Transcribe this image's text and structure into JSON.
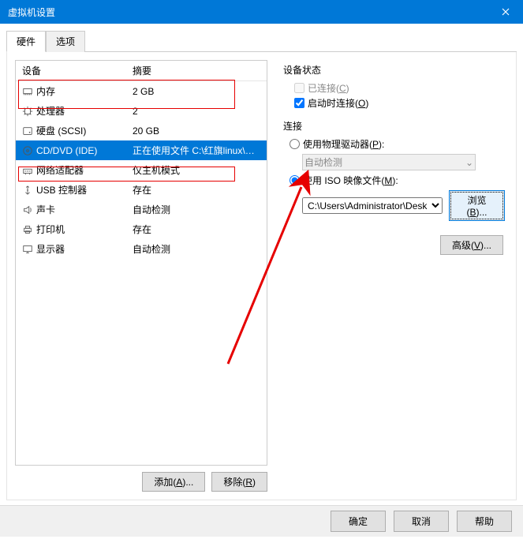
{
  "title": "虚拟机设置",
  "tabs": {
    "hardware": "硬件",
    "options": "选项"
  },
  "hw": {
    "headers": {
      "device": "设备",
      "summary": "摘要"
    },
    "items": [
      {
        "icon": "memory",
        "label": "内存",
        "summary": "2 GB"
      },
      {
        "icon": "cpu",
        "label": "处理器",
        "summary": "2"
      },
      {
        "icon": "disk",
        "label": "硬盘 (SCSI)",
        "summary": "20 GB"
      },
      {
        "icon": "cd",
        "label": "CD/DVD (IDE)",
        "summary": "正在使用文件 C:\\红旗linux\\红旗..."
      },
      {
        "icon": "net",
        "label": "网络适配器",
        "summary": "仅主机模式"
      },
      {
        "icon": "usb",
        "label": "USB 控制器",
        "summary": "存在"
      },
      {
        "icon": "sound",
        "label": "声卡",
        "summary": "自动检测"
      },
      {
        "icon": "printer",
        "label": "打印机",
        "summary": "存在"
      },
      {
        "icon": "display",
        "label": "显示器",
        "summary": "自动检测"
      }
    ],
    "selected_index": 3
  },
  "buttons": {
    "add": "添加(A)...",
    "remove": "移除(R)"
  },
  "right": {
    "status_label": "设备状态",
    "connected": "已连接(C)",
    "connect_at_poweron": "启动时连接(O)",
    "connect_label": "连接",
    "use_physical": "使用物理驱动器(P):",
    "auto_detect": "自动检测",
    "use_iso": "使用 ISO 映像文件(M):",
    "iso_path": "C:\\Users\\Administrator\\Desk",
    "browse": "浏览(B)...",
    "advanced": "高级(V)..."
  },
  "footer": {
    "ok": "确定",
    "cancel": "取消",
    "help": "帮助"
  },
  "checks": {
    "connected": false,
    "poweron": true
  },
  "radio_iso": true,
  "colors": {
    "accent": "#0078d7",
    "annotation": "#e60000"
  }
}
